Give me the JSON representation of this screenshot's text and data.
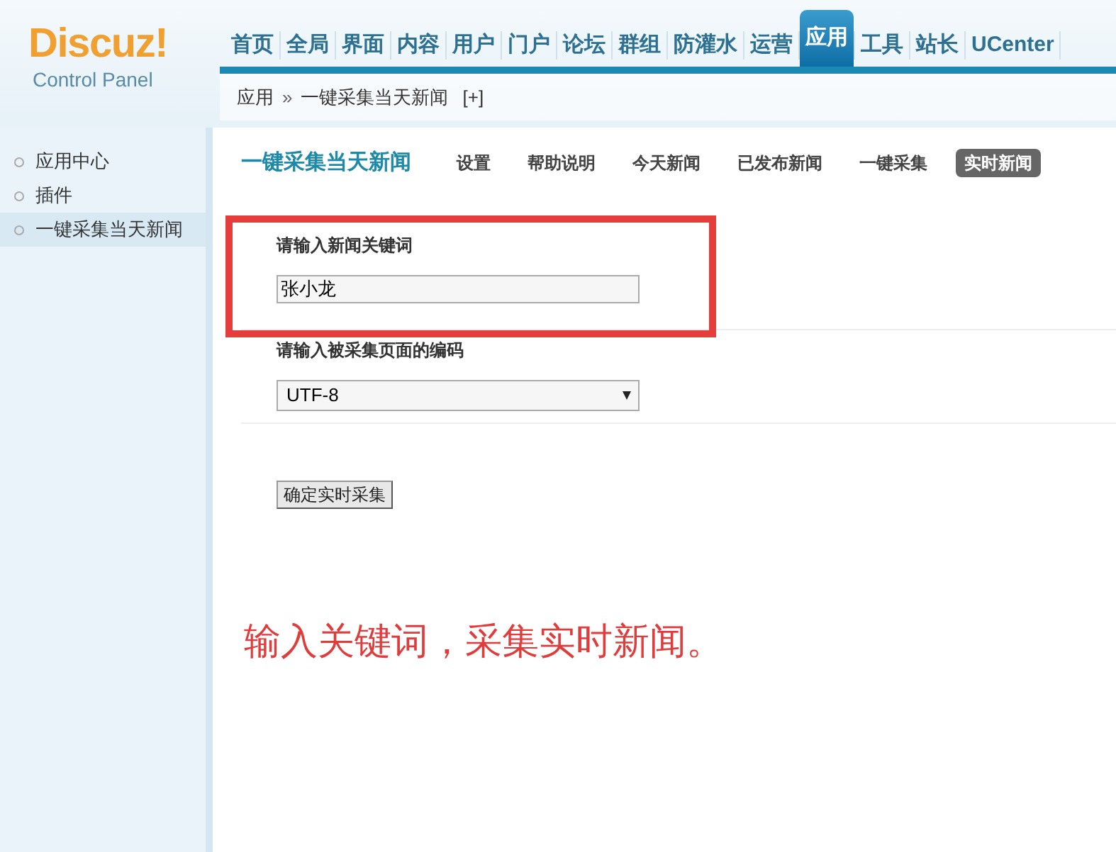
{
  "logo": {
    "name": "Discuz!",
    "subtitle": "Control Panel"
  },
  "nav": [
    {
      "label": "首页",
      "selected": false
    },
    {
      "label": "全局",
      "selected": false
    },
    {
      "label": "界面",
      "selected": false
    },
    {
      "label": "内容",
      "selected": false
    },
    {
      "label": "用户",
      "selected": false
    },
    {
      "label": "门户",
      "selected": false
    },
    {
      "label": "论坛",
      "selected": false
    },
    {
      "label": "群组",
      "selected": false
    },
    {
      "label": "防灌水",
      "selected": false
    },
    {
      "label": "运营",
      "selected": false
    },
    {
      "label": "应用",
      "selected": true
    },
    {
      "label": "工具",
      "selected": false
    },
    {
      "label": "站长",
      "selected": false
    },
    {
      "label": "UCenter",
      "selected": false
    }
  ],
  "breadcrumb": {
    "items": [
      "应用",
      "一键采集当天新闻"
    ],
    "separator": "»",
    "add": "[+]"
  },
  "sidebar": {
    "items": [
      {
        "label": "应用中心",
        "selected": false
      },
      {
        "label": "插件",
        "selected": false
      },
      {
        "label": "一键采集当天新闻",
        "selected": true
      }
    ]
  },
  "page_title": "一键采集当天新闻",
  "subnav": [
    {
      "label": "设置",
      "selected": false
    },
    {
      "label": "帮助说明",
      "selected": false
    },
    {
      "label": "今天新闻",
      "selected": false
    },
    {
      "label": "已发布新闻",
      "selected": false
    },
    {
      "label": "一键采集",
      "selected": false
    },
    {
      "label": "实时新闻",
      "selected": true
    }
  ],
  "form": {
    "keyword_label": "请输入新闻关键词",
    "keyword_value": "张小龙",
    "encoding_label": "请输入被采集页面的编码",
    "encoding_value": "UTF-8",
    "submit": "确定实时采集"
  },
  "annotation": {
    "text": "输入关键词，采集实时新闻。",
    "highlight": true
  }
}
